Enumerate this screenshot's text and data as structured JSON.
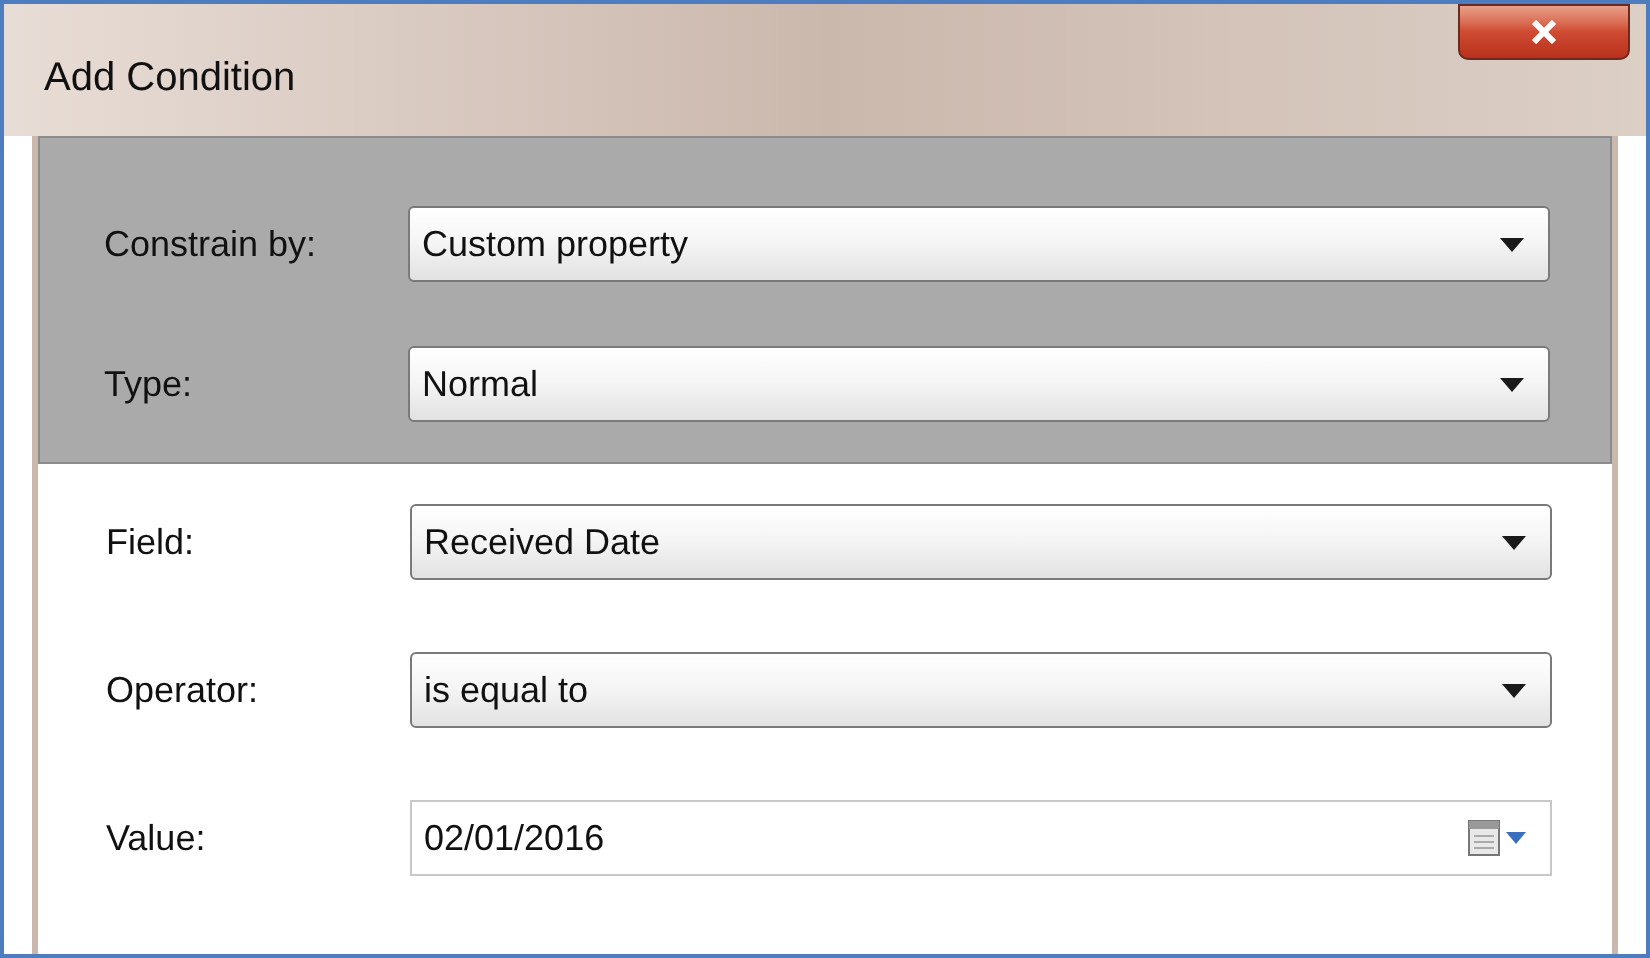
{
  "window": {
    "title": "Add Condition"
  },
  "constraint_rows": [
    {
      "label": "Constrain by:",
      "kind": "dropdown",
      "value": "Custom property"
    },
    {
      "label": "Type:",
      "kind": "dropdown",
      "value": "Normal"
    }
  ],
  "condition_rows": [
    {
      "label": "Field:",
      "kind": "dropdown",
      "value": "Received Date"
    },
    {
      "label": "Operator:",
      "kind": "dropdown",
      "value": "is equal to"
    },
    {
      "label": "Value:",
      "kind": "date",
      "value": "02/01/2016"
    }
  ]
}
